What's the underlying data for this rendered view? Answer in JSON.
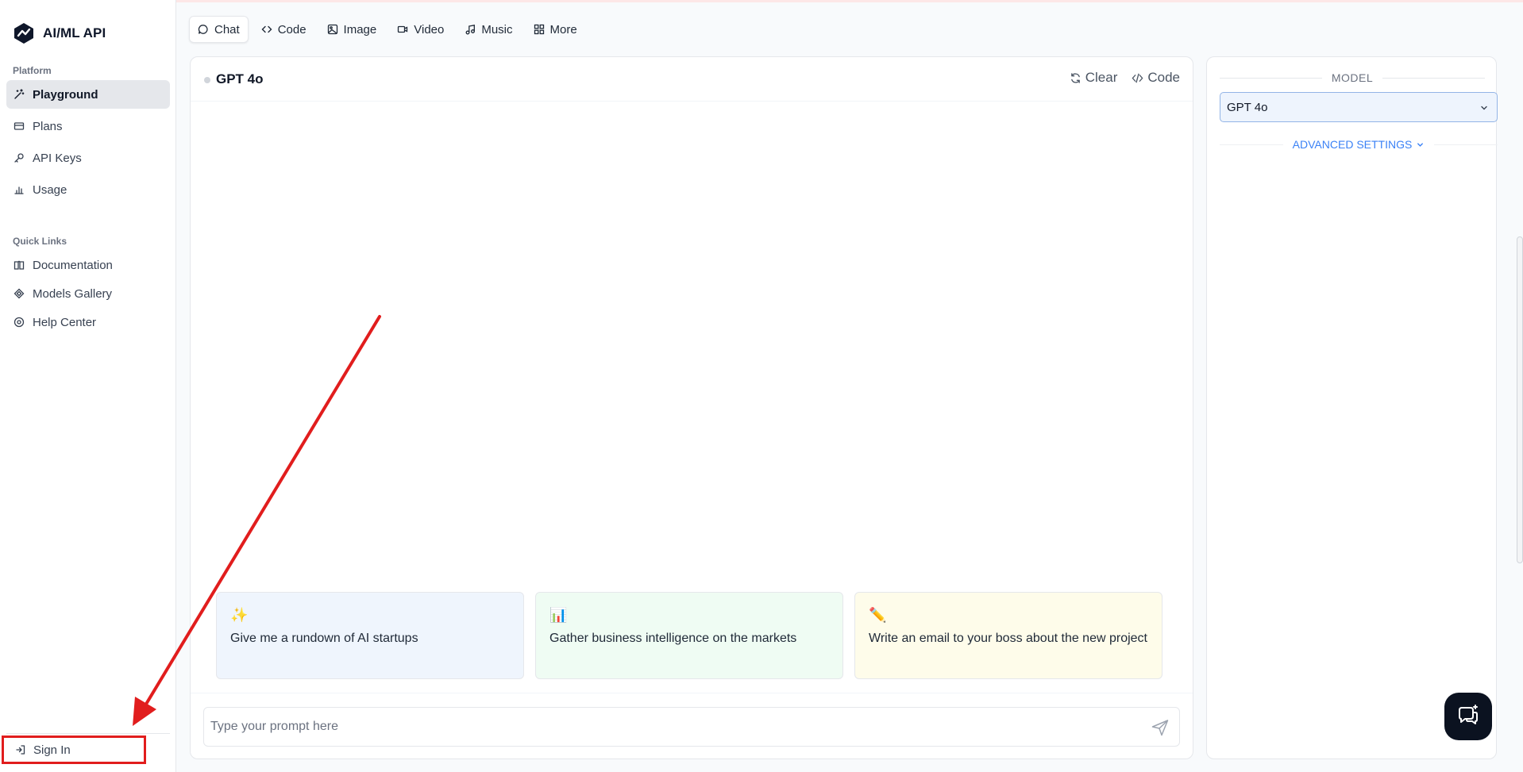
{
  "app": {
    "name": "AI/ML API"
  },
  "sidebar": {
    "platform_label": "Platform",
    "platform_items": [
      {
        "label": "Playground",
        "icon": "wand-icon",
        "active": true
      },
      {
        "label": "Plans",
        "icon": "card-icon"
      },
      {
        "label": "API Keys",
        "icon": "key-icon"
      },
      {
        "label": "Usage",
        "icon": "bar-chart-icon"
      }
    ],
    "quicklinks_label": "Quick Links",
    "quicklinks_items": [
      {
        "label": "Documentation",
        "icon": "book-icon"
      },
      {
        "label": "Models Gallery",
        "icon": "diamond-icon"
      },
      {
        "label": "Help Center",
        "icon": "help-circle-icon"
      }
    ],
    "signin_label": "Sign In"
  },
  "topbar": {
    "tabs": [
      {
        "label": "Chat",
        "icon": "chat-bubble-icon",
        "active": true
      },
      {
        "label": "Code",
        "icon": "code-icon"
      },
      {
        "label": "Image",
        "icon": "image-icon"
      },
      {
        "label": "Video",
        "icon": "video-icon"
      },
      {
        "label": "Music",
        "icon": "music-note-icon"
      },
      {
        "label": "More",
        "icon": "grid-icon"
      }
    ]
  },
  "chat": {
    "model_name": "GPT 4o",
    "clear_label": "Clear",
    "code_label": "Code",
    "suggestions": [
      {
        "emoji": "✨",
        "text": "Give me a rundown of AI startups"
      },
      {
        "emoji": "📊",
        "text": "Gather business intelligence on the markets"
      },
      {
        "emoji": "✏️",
        "text": "Write an email to your boss about the new project"
      }
    ],
    "prompt_placeholder": "Type your prompt here"
  },
  "settings": {
    "model_label": "MODEL",
    "selected_model": "GPT 4o",
    "advanced_label": "ADVANCED SETTINGS"
  },
  "colors": {
    "accent_blue": "#3b82f6",
    "annotation_red": "#e11d1d",
    "logo_dark": "#0f172a"
  }
}
